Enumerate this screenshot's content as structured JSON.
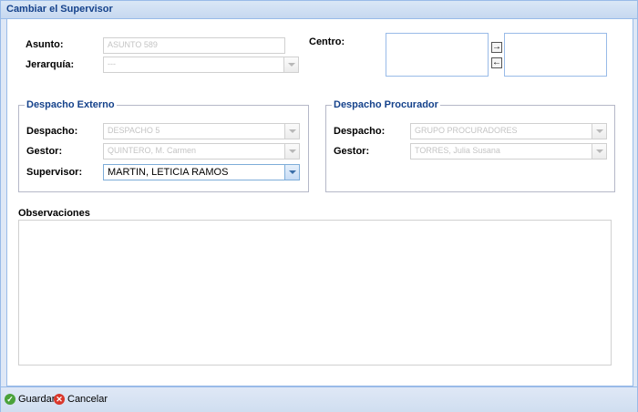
{
  "window": {
    "title": "Cambiar el Supervisor"
  },
  "form": {
    "asunto": {
      "label": "Asunto:",
      "value": "ASUNTO 589"
    },
    "jerarquia": {
      "label": "Jerarquía:",
      "value": "---"
    },
    "centro": {
      "label": "Centro:"
    }
  },
  "despacho_externo": {
    "legend": "Despacho Externo",
    "despacho": {
      "label": "Despacho:",
      "value": "DESPACHO 5"
    },
    "gestor": {
      "label": "Gestor:",
      "value": "QUINTERO, M. Carmen"
    },
    "supervisor": {
      "label": "Supervisor:",
      "value": "MARTIN, LETICIA RAMOS"
    }
  },
  "despacho_procurador": {
    "legend": "Despacho Procurador",
    "despacho": {
      "label": "Despacho:",
      "value": "GRUPO PROCURADORES"
    },
    "gestor": {
      "label": "Gestor:",
      "value": "TORRES, Julia Susana"
    }
  },
  "observaciones": {
    "label": "Observaciones",
    "value": ""
  },
  "footer": {
    "save_label": "Guardar",
    "cancel_label": "Cancelar"
  },
  "colors": {
    "title": "#15428b",
    "frame": "#99bbe8",
    "panel": "#dfe8f6"
  },
  "icons": {
    "add": "arrow-right-icon",
    "remove": "arrow-left-icon",
    "save": "check-circle-icon",
    "cancel": "cancel-circle-icon"
  }
}
